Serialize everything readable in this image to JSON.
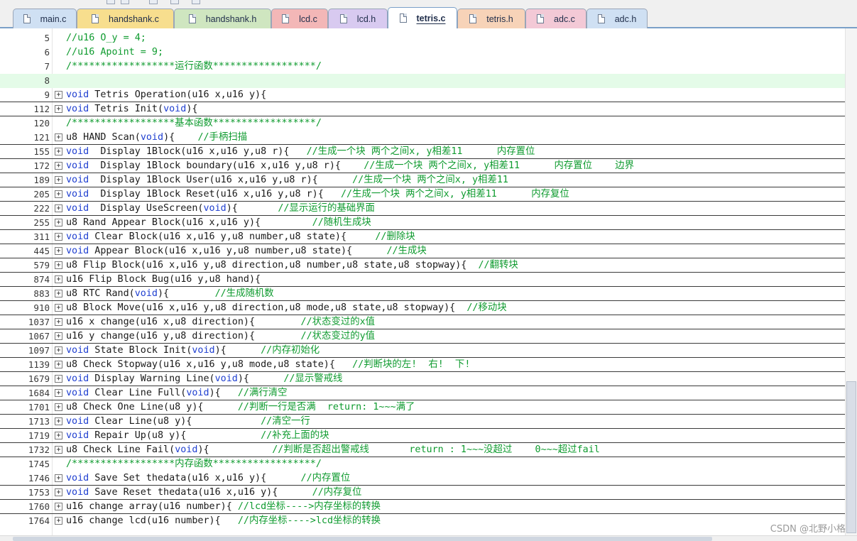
{
  "tabs": [
    {
      "label": "main.c",
      "color": "#cfe0f3"
    },
    {
      "label": "handshank.c",
      "color": "#f7de8e"
    },
    {
      "label": "handshank.h",
      "color": "#cfe6c0"
    },
    {
      "label": "lcd.c",
      "color": "#f3b7b7"
    },
    {
      "label": "lcd.h",
      "color": "#d8caf0"
    },
    {
      "label": "tetris.c",
      "color": "#ffffff",
      "active": true
    },
    {
      "label": "tetris.h",
      "color": "#f7d3b8"
    },
    {
      "label": "adc.c",
      "color": "#f3c9d6"
    },
    {
      "label": "adc.h",
      "color": "#cfe0f3"
    }
  ],
  "lines": [
    {
      "num": "5",
      "fold": false,
      "sep": false,
      "hl": false,
      "code": [
        {
          "t": "//u16 O_y = 4;",
          "c": "cm"
        }
      ]
    },
    {
      "num": "6",
      "fold": false,
      "sep": false,
      "hl": false,
      "code": [
        {
          "t": "//u16 Apoint = 9;",
          "c": "cm"
        }
      ]
    },
    {
      "num": "7",
      "fold": false,
      "sep": false,
      "hl": false,
      "code": [
        {
          "t": "/******************运行函数******************/",
          "c": "cm"
        }
      ]
    },
    {
      "num": "8",
      "fold": false,
      "sep": false,
      "hl": true,
      "code": []
    },
    {
      "num": "9",
      "fold": true,
      "sep": true,
      "hl": false,
      "code": [
        {
          "t": "void",
          "c": "kw"
        },
        {
          "t": " Tetris Operation(u16 x,u16 y){",
          "c": ""
        }
      ]
    },
    {
      "num": "112",
      "fold": true,
      "sep": true,
      "hl": false,
      "code": [
        {
          "t": "void",
          "c": "kw"
        },
        {
          "t": " Tetris Init(",
          "c": ""
        },
        {
          "t": "void",
          "c": "kw"
        },
        {
          "t": "){",
          "c": ""
        }
      ]
    },
    {
      "num": "120",
      "fold": false,
      "sep": false,
      "hl": false,
      "code": [
        {
          "t": "/******************基本函数******************/",
          "c": "cm"
        }
      ]
    },
    {
      "num": "121",
      "fold": true,
      "sep": true,
      "hl": false,
      "code": [
        {
          "t": "u8 HAND Scan(",
          "c": ""
        },
        {
          "t": "void",
          "c": "kw"
        },
        {
          "t": "){    ",
          "c": ""
        },
        {
          "t": "//手柄扫描",
          "c": "cm"
        }
      ]
    },
    {
      "num": "155",
      "fold": true,
      "sep": true,
      "hl": false,
      "code": [
        {
          "t": "void",
          "c": "kw"
        },
        {
          "t": "  Display 1Block(u16 x,u16 y,u8 r){   ",
          "c": ""
        },
        {
          "t": "//生成一个块 两个之间x, y相差11      内存置位",
          "c": "cm"
        }
      ]
    },
    {
      "num": "172",
      "fold": true,
      "sep": true,
      "hl": false,
      "code": [
        {
          "t": "void",
          "c": "kw"
        },
        {
          "t": "  Display 1Block boundary(u16 x,u16 y,u8 r){    ",
          "c": ""
        },
        {
          "t": "//生成一个块 两个之间x, y相差11      内存置位    边界",
          "c": "cm"
        }
      ]
    },
    {
      "num": "189",
      "fold": true,
      "sep": true,
      "hl": false,
      "code": [
        {
          "t": "void",
          "c": "kw"
        },
        {
          "t": "  Display 1Block User(u16 x,u16 y,u8 r){      ",
          "c": ""
        },
        {
          "t": "//生成一个块 两个之间x, y相差11",
          "c": "cm"
        }
      ]
    },
    {
      "num": "205",
      "fold": true,
      "sep": true,
      "hl": false,
      "code": [
        {
          "t": "void",
          "c": "kw"
        },
        {
          "t": "  Display 1Block Reset(u16 x,u16 y,u8 r){   ",
          "c": ""
        },
        {
          "t": "//生成一个块 两个之间x, y相差11      内存复位",
          "c": "cm"
        }
      ]
    },
    {
      "num": "222",
      "fold": true,
      "sep": true,
      "hl": false,
      "code": [
        {
          "t": "void",
          "c": "kw"
        },
        {
          "t": "  Display UseScreen(",
          "c": ""
        },
        {
          "t": "void",
          "c": "kw"
        },
        {
          "t": "){       ",
          "c": ""
        },
        {
          "t": "//显示运行的基础界面",
          "c": "cm"
        }
      ]
    },
    {
      "num": "255",
      "fold": true,
      "sep": true,
      "hl": false,
      "code": [
        {
          "t": "u8 Rand Appear Block(u16 x,u16 y){         ",
          "c": ""
        },
        {
          "t": "//随机生成块",
          "c": "cm"
        }
      ]
    },
    {
      "num": "311",
      "fold": true,
      "sep": true,
      "hl": false,
      "code": [
        {
          "t": "void",
          "c": "kw"
        },
        {
          "t": " Clear Block(u16 x,u16 y,u8 number,u8 state){     ",
          "c": ""
        },
        {
          "t": "//删除块",
          "c": "cm"
        }
      ]
    },
    {
      "num": "445",
      "fold": true,
      "sep": true,
      "hl": false,
      "code": [
        {
          "t": "void",
          "c": "kw"
        },
        {
          "t": " Appear Block(u16 x,u16 y,u8 number,u8 state){      ",
          "c": ""
        },
        {
          "t": "//生成块",
          "c": "cm"
        }
      ]
    },
    {
      "num": "579",
      "fold": true,
      "sep": true,
      "hl": false,
      "code": [
        {
          "t": "u8 Flip Block(u16 x,u16 y,u8 direction,u8 number,u8 state,u8 stopway){  ",
          "c": ""
        },
        {
          "t": "//翻转块",
          "c": "cm"
        }
      ]
    },
    {
      "num": "874",
      "fold": true,
      "sep": true,
      "hl": false,
      "code": [
        {
          "t": "u16 Flip Block Bug(u16 y,u8 hand){",
          "c": ""
        }
      ]
    },
    {
      "num": "883",
      "fold": true,
      "sep": true,
      "hl": false,
      "code": [
        {
          "t": "u8 RTC Rand(",
          "c": ""
        },
        {
          "t": "void",
          "c": "kw"
        },
        {
          "t": "){        ",
          "c": ""
        },
        {
          "t": "//生成随机数",
          "c": "cm"
        }
      ]
    },
    {
      "num": "910",
      "fold": true,
      "sep": true,
      "hl": false,
      "code": [
        {
          "t": "u8 Block Move(u16 x,u16 y,u8 direction,u8 mode,u8 state,u8 stopway){  ",
          "c": ""
        },
        {
          "t": "//移动块",
          "c": "cm"
        }
      ]
    },
    {
      "num": "1037",
      "fold": true,
      "sep": true,
      "hl": false,
      "code": [
        {
          "t": "u16 x change(u16 x,u8 direction){        ",
          "c": ""
        },
        {
          "t": "//状态变过的x值",
          "c": "cm"
        }
      ]
    },
    {
      "num": "1067",
      "fold": true,
      "sep": true,
      "hl": false,
      "code": [
        {
          "t": "u16 y change(u16 y,u8 direction){        ",
          "c": ""
        },
        {
          "t": "//状态变过的y值",
          "c": "cm"
        }
      ]
    },
    {
      "num": "1097",
      "fold": true,
      "sep": true,
      "hl": false,
      "code": [
        {
          "t": "void",
          "c": "kw"
        },
        {
          "t": " State Block Init(",
          "c": ""
        },
        {
          "t": "void",
          "c": "kw"
        },
        {
          "t": "){      ",
          "c": ""
        },
        {
          "t": "//内存初始化",
          "c": "cm"
        }
      ]
    },
    {
      "num": "1139",
      "fold": true,
      "sep": true,
      "hl": false,
      "code": [
        {
          "t": "u8 Check Stopway(u16 x,u16 y,u8 mode,u8 state){   ",
          "c": ""
        },
        {
          "t": "//判断块的左!  右!  下!",
          "c": "cm"
        }
      ]
    },
    {
      "num": "1679",
      "fold": true,
      "sep": true,
      "hl": false,
      "code": [
        {
          "t": "void",
          "c": "kw"
        },
        {
          "t": " Display Warning Line(",
          "c": ""
        },
        {
          "t": "void",
          "c": "kw"
        },
        {
          "t": "){      ",
          "c": ""
        },
        {
          "t": "//显示警戒线",
          "c": "cm"
        }
      ]
    },
    {
      "num": "1684",
      "fold": true,
      "sep": true,
      "hl": false,
      "code": [
        {
          "t": "void",
          "c": "kw"
        },
        {
          "t": " Clear Line Full(",
          "c": ""
        },
        {
          "t": "void",
          "c": "kw"
        },
        {
          "t": "){   ",
          "c": ""
        },
        {
          "t": "//满行清空",
          "c": "cm"
        }
      ]
    },
    {
      "num": "1701",
      "fold": true,
      "sep": true,
      "hl": false,
      "code": [
        {
          "t": "u8 Check One Line(u8 y){      ",
          "c": ""
        },
        {
          "t": "//判断一行是否满  return: 1~~~满了",
          "c": "cm"
        }
      ]
    },
    {
      "num": "1713",
      "fold": true,
      "sep": true,
      "hl": false,
      "code": [
        {
          "t": "void",
          "c": "kw"
        },
        {
          "t": " Clear Line(u8 y){            ",
          "c": ""
        },
        {
          "t": "//清空一行",
          "c": "cm"
        }
      ]
    },
    {
      "num": "1719",
      "fold": true,
      "sep": true,
      "hl": false,
      "code": [
        {
          "t": "void",
          "c": "kw"
        },
        {
          "t": " Repair Up(u8 y){             ",
          "c": ""
        },
        {
          "t": "//补充上面的块",
          "c": "cm"
        }
      ]
    },
    {
      "num": "1732",
      "fold": true,
      "sep": true,
      "hl": false,
      "code": [
        {
          "t": "u8 Check Line Fail(",
          "c": ""
        },
        {
          "t": "void",
          "c": "kw"
        },
        {
          "t": "){           ",
          "c": ""
        },
        {
          "t": "//判断是否超出警戒线       return : 1~~~没超过    0~~~超过fail",
          "c": "cm"
        }
      ]
    },
    {
      "num": "1745",
      "fold": false,
      "sep": false,
      "hl": false,
      "code": [
        {
          "t": "/******************内存函数******************/",
          "c": "cm"
        }
      ]
    },
    {
      "num": "1746",
      "fold": true,
      "sep": true,
      "hl": false,
      "code": [
        {
          "t": "void",
          "c": "kw"
        },
        {
          "t": " Save Set thedata(u16 x,u16 y){      ",
          "c": ""
        },
        {
          "t": "//内存置位",
          "c": "cm"
        }
      ]
    },
    {
      "num": "1753",
      "fold": true,
      "sep": true,
      "hl": false,
      "code": [
        {
          "t": "void",
          "c": "kw"
        },
        {
          "t": " Save Reset thedata(u16 x,u16 y){      ",
          "c": ""
        },
        {
          "t": "//内存复位",
          "c": "cm"
        }
      ]
    },
    {
      "num": "1760",
      "fold": true,
      "sep": true,
      "hl": false,
      "code": [
        {
          "t": "u16 change array(u16 number){ ",
          "c": ""
        },
        {
          "t": "//lcd坐标---->内存坐标的转换",
          "c": "cm"
        }
      ]
    },
    {
      "num": "1764",
      "fold": true,
      "sep": false,
      "hl": false,
      "code": [
        {
          "t": "u16 change lcd(u16 number){   ",
          "c": ""
        },
        {
          "t": "//内存坐标---->lcd坐标的转换",
          "c": "cm"
        }
      ]
    }
  ],
  "watermark": "CSDN @北野小格"
}
